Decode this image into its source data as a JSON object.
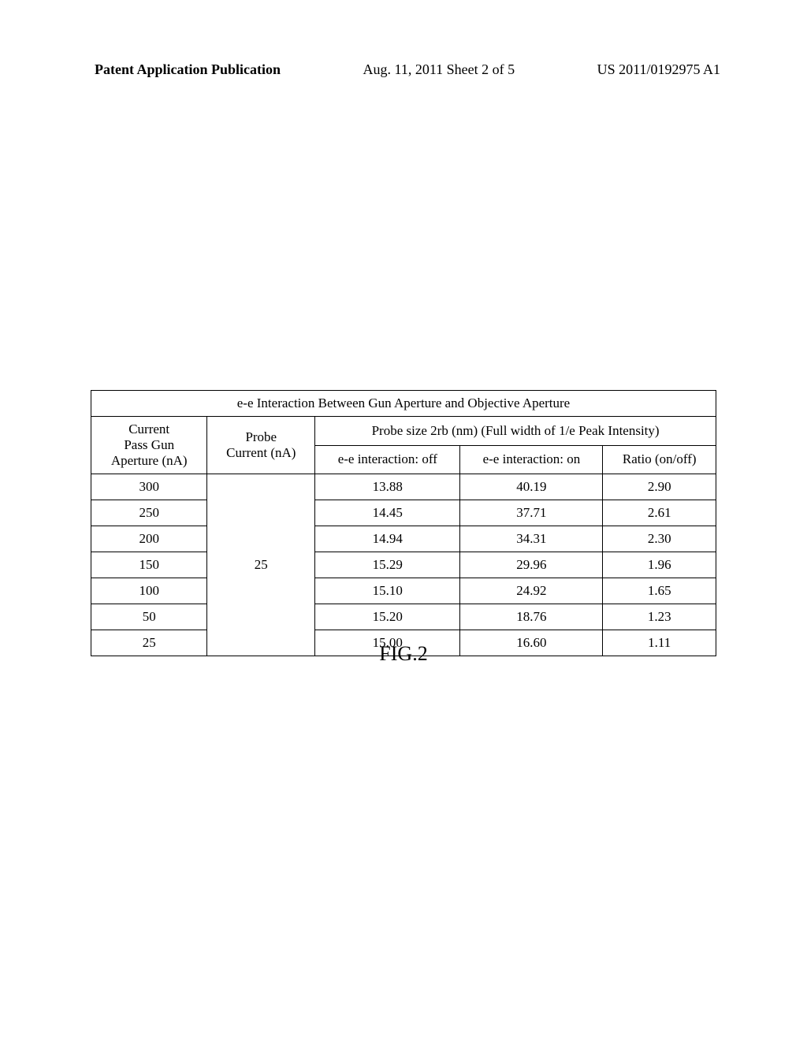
{
  "header": {
    "left": "Patent Application Publication",
    "center": "Aug. 11, 2011  Sheet 2 of 5",
    "right": "US 2011/0192975 A1"
  },
  "table": {
    "title": "e-e Interaction Between Gun Aperture and Objective Aperture",
    "col1_header_line1": "Current",
    "col1_header_line2": "Pass Gun",
    "col1_header_line3": "Aperture (nA)",
    "col2_header_line1": "Probe",
    "col2_header_line2": "Current (nA)",
    "col3_group_header": "Probe size 2rb (nm) (Full width of 1/e Peak Intensity)",
    "col3_sub1": "e-e interaction: off",
    "col3_sub2": "e-e interaction: on",
    "col3_sub3": "Ratio (on/off)",
    "probe_current": "25",
    "rows": [
      {
        "current": "300",
        "off": "13.88",
        "on": "40.19",
        "ratio": "2.90"
      },
      {
        "current": "250",
        "off": "14.45",
        "on": "37.71",
        "ratio": "2.61"
      },
      {
        "current": "200",
        "off": "14.94",
        "on": "34.31",
        "ratio": "2.30"
      },
      {
        "current": "150",
        "off": "15.29",
        "on": "29.96",
        "ratio": "1.96"
      },
      {
        "current": "100",
        "off": "15.10",
        "on": "24.92",
        "ratio": "1.65"
      },
      {
        "current": "50",
        "off": "15.20",
        "on": "18.76",
        "ratio": "1.23"
      },
      {
        "current": "25",
        "off": "15.00",
        "on": "16.60",
        "ratio": "1.11"
      }
    ]
  },
  "figure_label": "FIG.2"
}
